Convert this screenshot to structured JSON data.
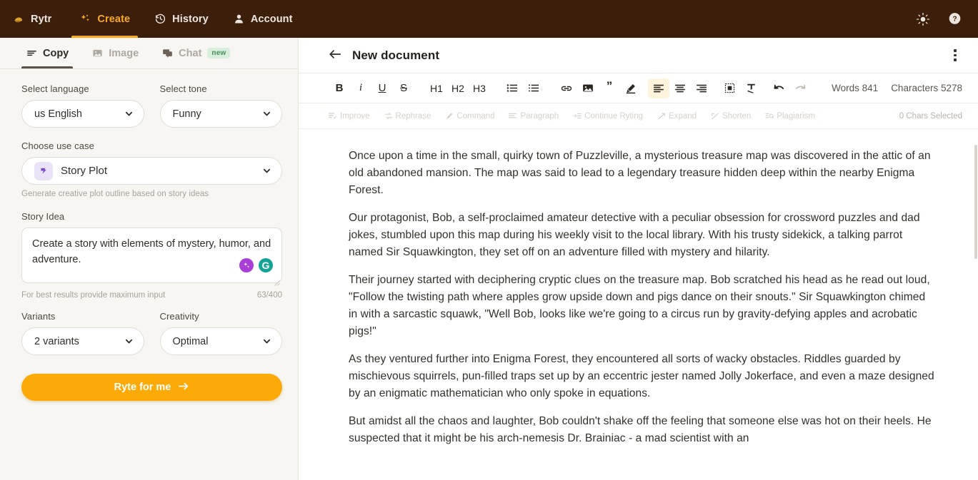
{
  "topnav": {
    "items": [
      {
        "label": "Rytr",
        "icon": "rytr-logo-icon",
        "active": false
      },
      {
        "label": "Create",
        "icon": "sparkle-icon",
        "active": true
      },
      {
        "label": "History",
        "icon": "history-clock-icon",
        "active": false
      },
      {
        "label": "Account",
        "icon": "person-icon",
        "active": false
      }
    ],
    "right_icons": [
      {
        "name": "theme-sun-icon"
      },
      {
        "name": "help-question-icon"
      }
    ],
    "background": "#3B1F0B",
    "accent": "#FBA919"
  },
  "left_panel": {
    "mode_tabs": [
      {
        "label": "Copy",
        "icon": "lines-icon",
        "active": true,
        "badge": ""
      },
      {
        "label": "Image",
        "icon": "picture-icon",
        "active": false,
        "badge": ""
      },
      {
        "label": "Chat",
        "icon": "chat-bubbles-icon",
        "active": false,
        "badge": "new"
      }
    ],
    "language": {
      "label": "Select language",
      "value": "us English"
    },
    "tone": {
      "label": "Select tone",
      "value": "Funny"
    },
    "use_case": {
      "label": "Choose use case",
      "value": "Story Plot",
      "hint": "Generate creative plot outline based on story ideas"
    },
    "story_idea": {
      "label": "Story Idea",
      "value": "Create a story with elements of mystery, humor, and adventure.",
      "placeholder": "Create a story with elements of mystery, humor, and adventure.",
      "hint": "For best results provide maximum input",
      "counter": "63/400"
    },
    "variants": {
      "label": "Variants",
      "value": "2 variants"
    },
    "creativity": {
      "label": "Creativity",
      "value": "Optimal"
    },
    "submit": {
      "label": "Ryte for me",
      "color": "#FBAA07"
    }
  },
  "editor": {
    "doc_title": "New document",
    "format_buttons": [
      {
        "name": "bold",
        "glyph": "B"
      },
      {
        "name": "italic",
        "glyph": "i"
      },
      {
        "name": "underline",
        "glyph": "U"
      },
      {
        "name": "strikethrough",
        "glyph": "S"
      },
      {
        "name": "heading-1",
        "glyph": "H1"
      },
      {
        "name": "heading-2",
        "glyph": "H2"
      },
      {
        "name": "heading-3",
        "glyph": "H3"
      }
    ],
    "words_label": "Words 841",
    "characters_label": "Characters 5278",
    "ai_actions": [
      "Improve",
      "Rephrase",
      "Command",
      "Paragraph",
      "Continue Ryting",
      "Expand",
      "Shorten",
      "Plagiarism"
    ],
    "selected_chars": "0 Chars Selected",
    "paragraphs": [
      "Once upon a time in the small, quirky town of Puzzleville, a mysterious treasure map was discovered in the attic of an old abandoned mansion. The map was said to lead to a legendary treasure hidden deep within the nearby Enigma Forest.",
      "Our protagonist, Bob, a self-proclaimed amateur detective with a peculiar obsession for crossword puzzles and dad jokes, stumbled upon this map during his weekly visit to the local library. With his trusty sidekick, a talking parrot named Sir Squawkington, they set off on an adventure filled with mystery and hilarity.",
      "Their journey started with deciphering cryptic clues on the treasure map. Bob scratched his head as he read out loud, \"Follow the twisting path where apples grow upside down and pigs dance on their snouts.\" Sir Squawkington chimed in with a sarcastic squawk, \"Well Bob, looks like we're going to a circus run by gravity-defying apples and acrobatic pigs!\"",
      "As they ventured further into Enigma Forest, they encountered all sorts of wacky obstacles. Riddles guarded by mischievous squirrels, pun-filled traps set up by an eccentric jester named Jolly Jokerface, and even a maze designed by an enigmatic mathematician who only spoke in equations.",
      "But amidst all the chaos and laughter, Bob couldn't shake off the feeling that someone else was hot on their heels. He suspected that it might be his arch-nemesis Dr. Brainiac - a mad scientist with an"
    ]
  }
}
